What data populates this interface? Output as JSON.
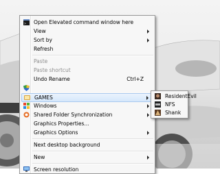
{
  "context_menu": {
    "items": [
      {
        "label": "Open Elevated command window here",
        "icon": "command-prompt-icon"
      },
      {
        "label": "View",
        "submenu": true
      },
      {
        "label": "Sort by",
        "submenu": true
      },
      {
        "label": "Refresh"
      },
      {
        "label": "Paste",
        "disabled": true
      },
      {
        "label": "Paste shortcut",
        "disabled": true
      },
      {
        "label": "Undo Rename",
        "shortcut": "Ctrl+Z"
      },
      {
        "label": "",
        "icon": "uac-shield-icon"
      },
      {
        "label": "GAMES",
        "submenu": true,
        "highlighted": true,
        "icon": "games-icon"
      },
      {
        "label": "Windows",
        "submenu": true,
        "icon": "windows-flag-icon"
      },
      {
        "label": "Shared Folder Synchronization",
        "submenu": true,
        "icon": "sync-icon"
      },
      {
        "label": "Graphics Properties..."
      },
      {
        "label": "Graphics Options",
        "submenu": true
      },
      {
        "label": "Next desktop background"
      },
      {
        "label": "New",
        "submenu": true
      },
      {
        "label": "Screen resolution",
        "icon": "display-icon"
      }
    ]
  },
  "games_submenu": {
    "items": [
      {
        "label": "ResidentEvil",
        "icon": "residentevil-game-icon"
      },
      {
        "label": "NFS",
        "icon": "nfs-game-icon"
      },
      {
        "label": "Shank",
        "icon": "shank-game-icon"
      }
    ]
  },
  "colors": {
    "menu_bg": "#f7f7f7",
    "highlight": "#d5e7fb",
    "highlight_border": "#a9c9ee",
    "disabled_text": "#8d8d8d"
  }
}
